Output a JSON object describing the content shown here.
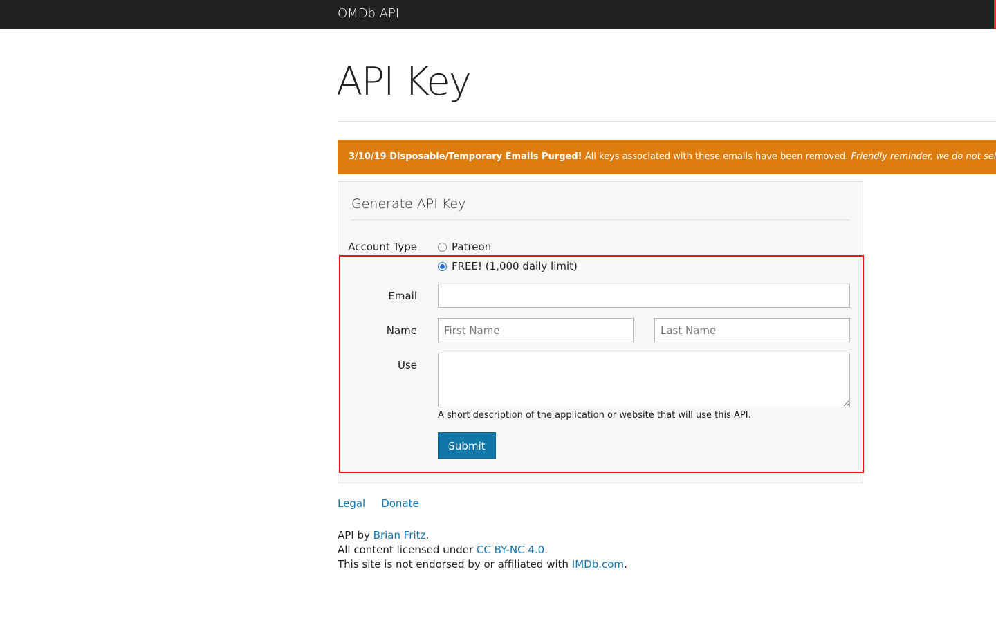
{
  "navbar": {
    "brand": "OMDb API"
  },
  "page": {
    "title": "API Key"
  },
  "alert": {
    "bold": "3/10/19 Disposable/Temporary Emails Purged!",
    "text": " All keys associated with these emails have been removed. ",
    "italic": "Friendly reminder, we do not sell or share your information"
  },
  "form": {
    "legend": "Generate API Key",
    "account_type_label": "Account Type",
    "options": [
      {
        "label": "Patreon",
        "checked": false
      },
      {
        "label": "FREE! (1,000 daily limit)",
        "checked": true
      }
    ],
    "email_label": "Email",
    "email_value": "",
    "name_label": "Name",
    "first_name_placeholder": "First Name",
    "last_name_placeholder": "Last Name",
    "use_label": "Use",
    "use_help": "A short description of the application or website that will use this API.",
    "submit_label": "Submit"
  },
  "footer": {
    "links": [
      "Legal",
      "Donate"
    ],
    "api_by_prefix": "API by ",
    "author": "Brian Fritz",
    "license_prefix": "All content licensed under ",
    "license": "CC BY-NC 4.0",
    "endorse_prefix": "This site is not endorsed by or affiliated with ",
    "imdb": "IMDb.com",
    "period": "."
  },
  "colors": {
    "navbar": "#222222",
    "alert": "#dd7d0f",
    "primary": "#0f78a8",
    "highlight": "#ee1111",
    "link": "#1276b3"
  }
}
